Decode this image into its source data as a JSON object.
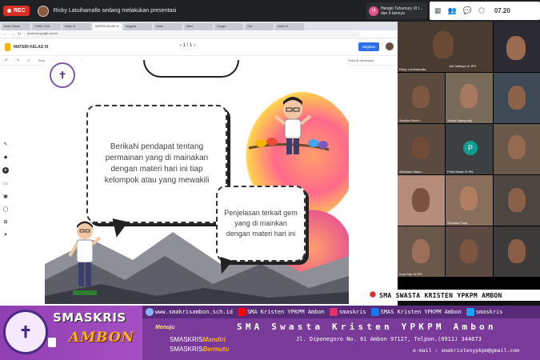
{
  "meet": {
    "rec_label": "REC",
    "presenting_text": "Ricky Latuihamallo sedang melakukan presentasi",
    "top_tile_name": "Hengki Tuhumury XI I...",
    "top_tile_sub": "dan 6 lainnya",
    "clock": "07.20"
  },
  "browser": {
    "tabs": [
      "Kelas Virtual",
      "TOEFL 2021",
      "Kelas XI",
      "MATERI KELAS XI",
      "Anggota",
      "Kelas",
      "Meet",
      "Google",
      "Cek",
      "Kelas XI"
    ],
    "url": "jamboard.google.com/d/...",
    "doc_title": "MATERI KELAS XI",
    "slide_counter": "‹  1 / 1  ›",
    "share_label": "Bagikan",
    "menu": [
      "Tetapkan latar belakang",
      "Hapus frame"
    ],
    "menu_right": "Buka di Jamboard"
  },
  "slide": {
    "bubble1": "BerikaN  pendapat tentang permainan yang di mainakan dengan materi hari ini tiap kelompok atau yang mewakili",
    "bubble2": "Penjelasan  terkait gem yang di mainkan dengan materi hari ini"
  },
  "participants": [
    {
      "name": "Ricky Latuihamallo",
      "color": "#4a3b30"
    },
    {
      "name": "Joli Salhaya XI IPS",
      "color": "#6b5546"
    },
    {
      "name": "",
      "color": "#2c2b33"
    },
    {
      "name": "Sariska Kelelo...",
      "color": "#5c4a3c"
    },
    {
      "name": "Yahna Manuputty",
      "color": "#7a6a5a"
    },
    {
      "name": "",
      "color": "#3f4a57"
    },
    {
      "name": "Abraham Mano...",
      "color": "#5a4a40"
    },
    {
      "name": "Prilla Warat XI IPA",
      "color": "#3c4043"
    },
    {
      "name": "",
      "color": "#6a5848"
    },
    {
      "name": "",
      "color": "#b58c7a"
    },
    {
      "name": "Selviana Tuny",
      "color": "#8a6e5c"
    },
    {
      "name": "",
      "color": "#4d4540"
    },
    {
      "name": "Irma Sae XI IPS",
      "color": "#6a584a"
    },
    {
      "name": "",
      "color": "#5a4a42"
    },
    {
      "name": "",
      "color": "#3d3a3a"
    }
  ],
  "participant_avatar_letter": "P",
  "school_tag": "SMA SWASTA KRISTEN YPKPM AMBON",
  "banner": {
    "brand": "SMASKRIS",
    "city": "AMBON",
    "website": "www.smakrisambon.sch.id",
    "youtube": "SMA Kristen YPKPM Ambon",
    "instagram": "smaskris",
    "facebook": "SMAS Kristen YPKPM Ambon",
    "twitter": "smaskris",
    "school_name": "SMA Swasta Kristen YPKPM Ambon",
    "motto_label": "Menuju",
    "motto1_a": "SMASKRIS",
    "motto1_b": "Mandiri",
    "motto2_a": "SMASKRIS",
    "motto2_b": "Bermutu",
    "address": "Jl. Diponegoro  No. 61 Ambon 97127, Telpon.(0911) 344673",
    "email": "e-mail : smakristenypkpm@gmail.com"
  },
  "colors": {
    "rec": "#d93025",
    "banner_purple": "#7a3a9a",
    "banner_orange": "#ffb11a"
  }
}
